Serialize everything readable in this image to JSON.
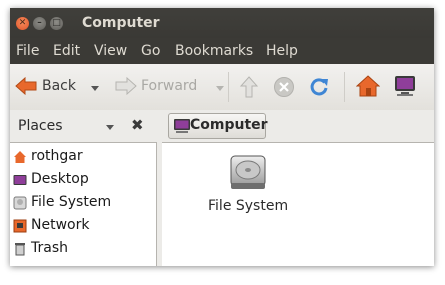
{
  "window": {
    "title": "Computer"
  },
  "menu": [
    "File",
    "Edit",
    "View",
    "Go",
    "Bookmarks",
    "Help"
  ],
  "toolbar": {
    "back_label": "Back",
    "forward_label": "Forward"
  },
  "location": {
    "crumb_label": "Computer"
  },
  "sidebar": {
    "header": "Places",
    "items": [
      {
        "label": "rothgar",
        "icon": "home-folder-icon"
      },
      {
        "label": "Desktop",
        "icon": "desktop-icon"
      },
      {
        "label": "File System",
        "icon": "drive-icon"
      },
      {
        "label": "Network",
        "icon": "network-icon"
      },
      {
        "label": "Trash",
        "icon": "trash-icon"
      }
    ]
  },
  "content": {
    "items": [
      {
        "label": "File System",
        "icon": "hard-disk-icon"
      }
    ]
  },
  "colors": {
    "accent_orange": "#e8682c",
    "desktop_purple": "#7a2d83",
    "titlebar": "#3c3b37"
  }
}
